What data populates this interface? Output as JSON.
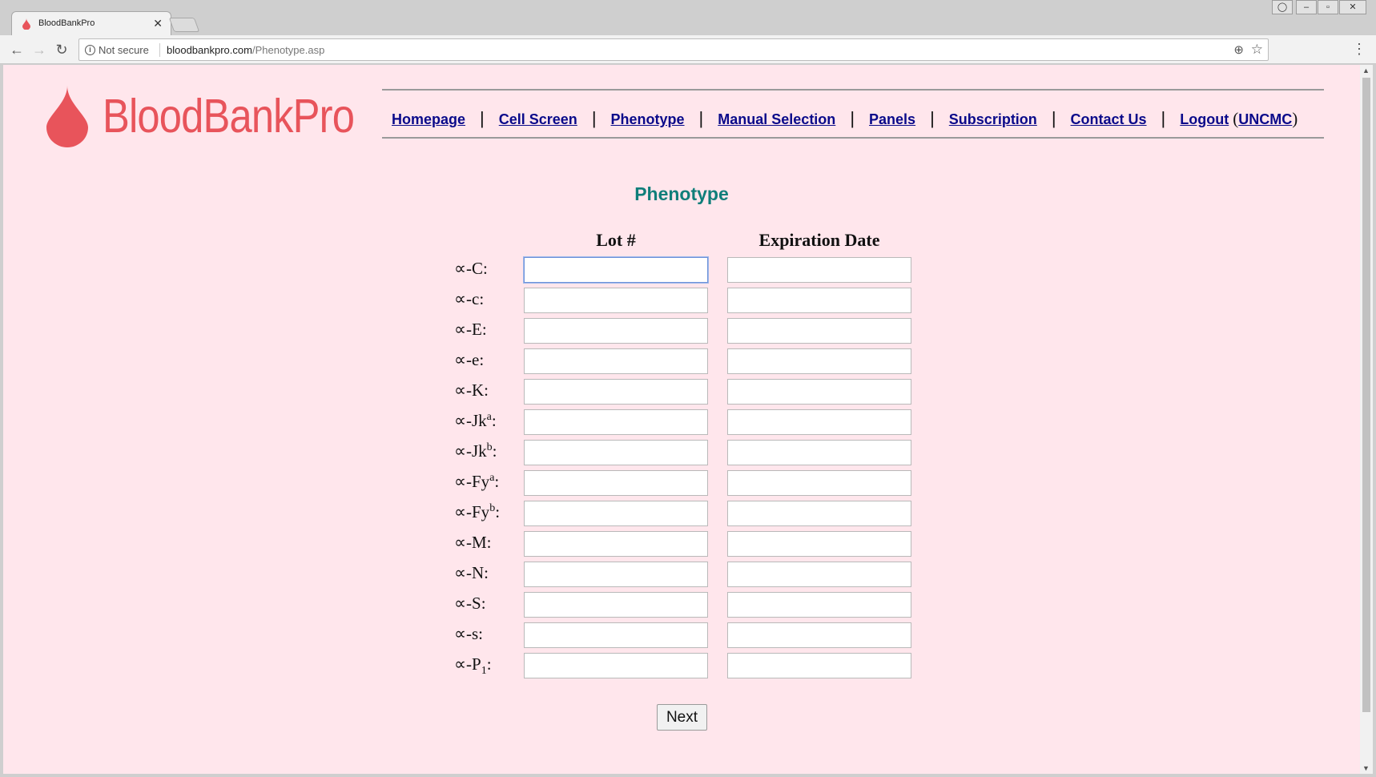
{
  "browser": {
    "tab_title": "BloodBankPro",
    "security_label": "Not secure",
    "url_host": "bloodbankpro.com",
    "url_path": "/Phenotype.asp"
  },
  "logo": {
    "text": "BloodBankPro",
    "color": "#e8545b"
  },
  "nav": {
    "items": [
      {
        "label": "Homepage"
      },
      {
        "label": "Cell Screen"
      },
      {
        "label": "Phenotype"
      },
      {
        "label": "Manual Selection"
      },
      {
        "label": "Panels"
      },
      {
        "label": "Subscription"
      },
      {
        "label": "Contact Us"
      },
      {
        "label": "Logout"
      }
    ],
    "divider": "|",
    "user": "UNCMC",
    "open_paren": "(",
    "close_paren": ")"
  },
  "page": {
    "heading": "Phenotype",
    "col_lot": "Lot #",
    "col_exp": "Expiration Date",
    "rows": [
      {
        "prefix": "∝-C",
        "sup": "",
        "sub": "",
        "suffix": ":"
      },
      {
        "prefix": "∝-c",
        "sup": "",
        "sub": "",
        "suffix": ":"
      },
      {
        "prefix": "∝-E",
        "sup": "",
        "sub": "",
        "suffix": ":"
      },
      {
        "prefix": "∝-e",
        "sup": "",
        "sub": "",
        "suffix": ":"
      },
      {
        "prefix": "∝-K",
        "sup": "",
        "sub": "",
        "suffix": ":"
      },
      {
        "prefix": "∝-Jk",
        "sup": "a",
        "sub": "",
        "suffix": ":"
      },
      {
        "prefix": "∝-Jk",
        "sup": "b",
        "sub": "",
        "suffix": ":"
      },
      {
        "prefix": "∝-Fy",
        "sup": "a",
        "sub": "",
        "suffix": ":"
      },
      {
        "prefix": "∝-Fy",
        "sup": "b",
        "sub": "",
        "suffix": ":"
      },
      {
        "prefix": "∝-M",
        "sup": "",
        "sub": "",
        "suffix": ":"
      },
      {
        "prefix": "∝-N",
        "sup": "",
        "sub": "",
        "suffix": ":"
      },
      {
        "prefix": "∝-S",
        "sup": "",
        "sub": "",
        "suffix": ":"
      },
      {
        "prefix": "∝-s",
        "sup": "",
        "sub": "",
        "suffix": ":"
      },
      {
        "prefix": "∝-P",
        "sup": "",
        "sub": "1",
        "suffix": ":"
      }
    ],
    "next_label": "Next"
  },
  "colors": {
    "page_bg": "#ffe6ec",
    "heading": "#0f7e7a",
    "link": "#0a0a8a"
  }
}
